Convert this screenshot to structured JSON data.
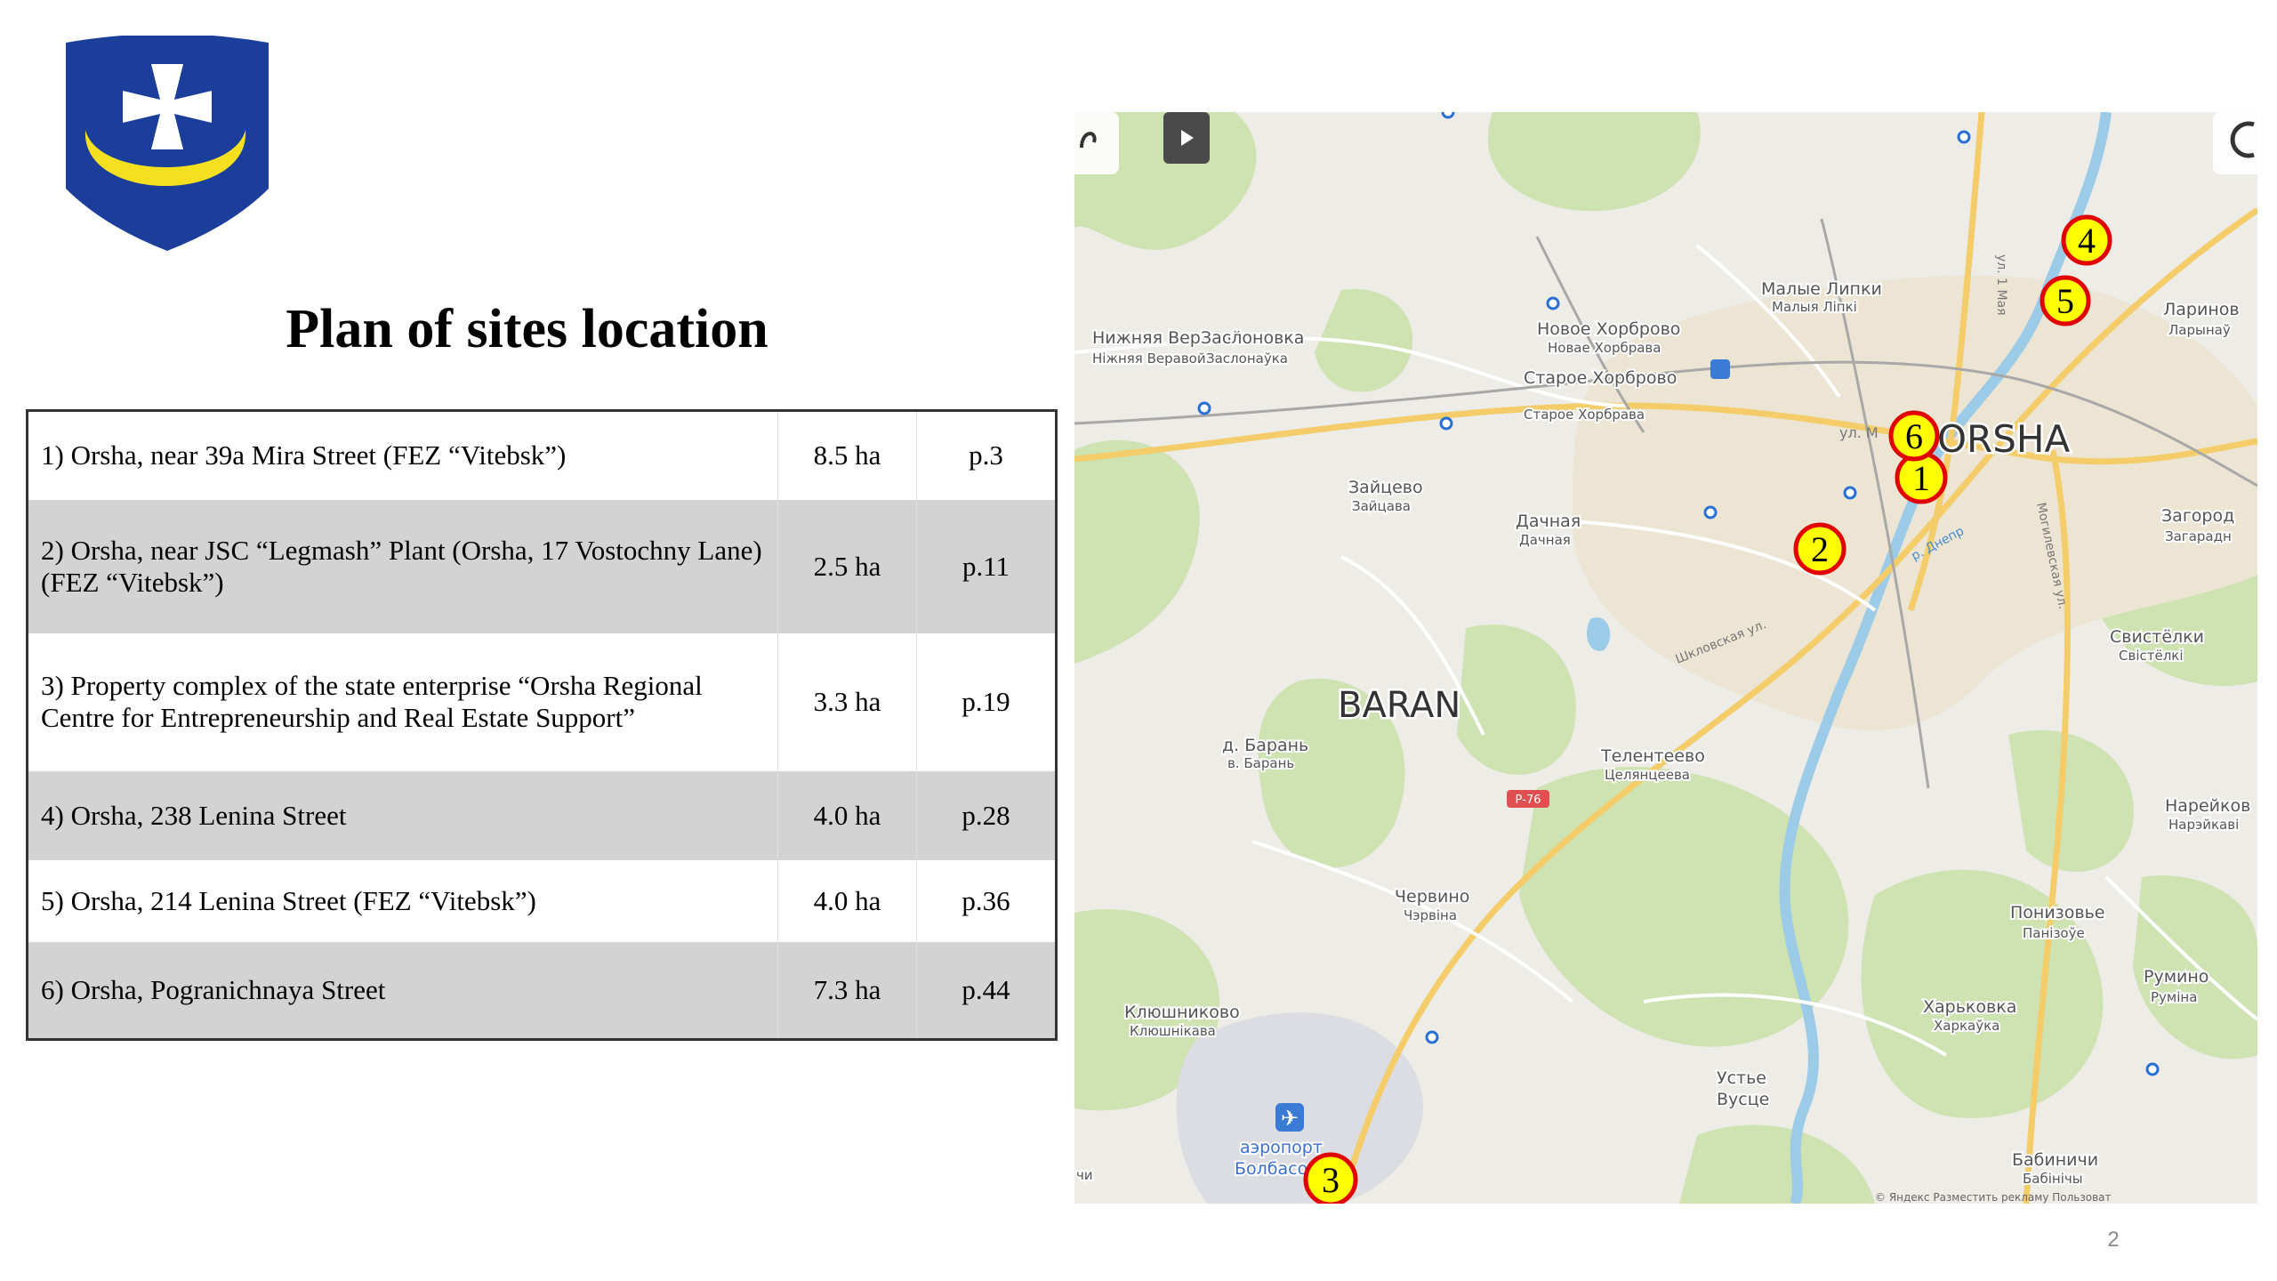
{
  "title": "Plan of sites location",
  "sites": [
    {
      "description": "1)   Orsha, near 39a Mira Street (FEZ “Vitebsk”)",
      "area": "8.5 ha",
      "page": "p.3"
    },
    {
      "description": "2) Orsha, near JSC “Legmash” Plant  (Orsha, 17 Vostochny Lane) (FEZ “Vitebsk”)",
      "area": "2.5 ha",
      "page": "p.11"
    },
    {
      "description": "3) Property complex of the state enterprise “Orsha Regional Centre for Entrepreneurship and Real Estate Support”",
      "area": "3.3 ha",
      "page": "p.19"
    },
    {
      "description": "4) Orsha, 238 Lenina Street",
      "area": "4.0 ha",
      "page": "p.28"
    },
    {
      "description": "5) Orsha, 214 Lenina Street (FEZ “Vitebsk”)",
      "area": "4.0 ha",
      "page": "p.36"
    },
    {
      "description": "6) Orsha, Pogranichnaya Street",
      "area": "7.3 ha",
      "page": "p.44"
    }
  ],
  "map": {
    "city_label": "ORSHA",
    "district_label": "BARAN",
    "markers": [
      "1",
      "2",
      "3",
      "4",
      "5",
      "6"
    ],
    "place_labels": {
      "nizhnyaya": "Нижняя Веравойша",
      "nizhnyaya_by": "Ніжняя Веравойша",
      "zaslonovka": "Заслоновка",
      "zaslonovka_by": "Заслонаўка",
      "novoe": "Новое Хорброво",
      "novoe_by": "Новае Хорбрава",
      "staroe": "Старое Хорброво",
      "staroe_by": "Старое Хорбрава",
      "malye": "Малые Липки",
      "malye_by": "Малыя Ліпкі",
      "larinovka": "Ларинов",
      "larinovka_by": "Ларынаў",
      "zaitsevo": "Зайцево",
      "zaitsevo_by": "Зайцава",
      "dachnaya": "Дачная",
      "dachnaya_by": "Дачная",
      "zagorodie": "Загород",
      "zagorodie_by": "Загарадн",
      "svistelki": "Свистёлки",
      "svistelki_by": "Свістёлкі",
      "baran_d": "д. Барань",
      "baran_d_by": "в. Барань",
      "telenteevo": "Телентеево",
      "telenteevo_by": "Целянцеева",
      "nareykovo": "Нарейков",
      "nareykovo_by": "Нарэйкаві",
      "chervino": "Червино",
      "chervino_by": "Чэрвіна",
      "ponizovye": "Понизовье",
      "ponizovye_by": "Панізоўе",
      "rumino": "Румино",
      "rumino_by": "Румiна",
      "klyushnikovo": "Клюшниково",
      "klyushnikovo_by": "Клюшнікава",
      "kharkovka": "Харьковка",
      "kharkovka_by": "Харкаўка",
      "ustye": "Устье",
      "vustse": "Вусце",
      "airport": "аэропорт",
      "airport_name": "Болбасово",
      "babinichi": "Бабиничи",
      "babinichi_by": "Бабінічы",
      "chi": "чи",
      "street_1maya": "ул. 1 Мая",
      "street_mogilev": "Могилевская ул.",
      "street_shklov": "Шкловская ул.",
      "river": "р. Днепр",
      "street_mira": "ул. М",
      "road_badge": "Р-76",
      "attribution": "© Яндекс  Разместить рекламу  Пользоват"
    }
  },
  "page_number": "2",
  "colors": {
    "shield_blue": "#1a3e9a",
    "crescent": "#f5e020",
    "marker_fill": "#ffff00",
    "marker_ring": "#e00000",
    "table_gray": "#d3d3d3",
    "map_land": "#edece7",
    "map_forest": "#cfe2b2",
    "map_water": "#9ccbe8"
  }
}
